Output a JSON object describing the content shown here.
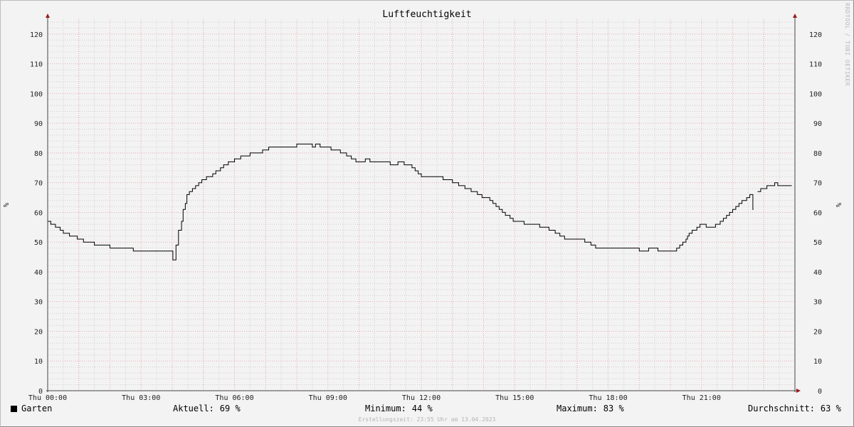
{
  "chart_data": {
    "type": "line",
    "title": "Luftfeuchtigkeit",
    "ylabel": "%",
    "ylim": [
      0,
      125
    ],
    "y_ticks": [
      0,
      10,
      20,
      30,
      40,
      50,
      60,
      70,
      80,
      90,
      100,
      110,
      120
    ],
    "x_range_hours": [
      0,
      24
    ],
    "x_ticks": [
      {
        "hour": 0,
        "label": "Thu 00:00"
      },
      {
        "hour": 3,
        "label": "Thu 03:00"
      },
      {
        "hour": 6,
        "label": "Thu 06:00"
      },
      {
        "hour": 9,
        "label": "Thu 09:00"
      },
      {
        "hour": 12,
        "label": "Thu 12:00"
      },
      {
        "hour": 15,
        "label": "Thu 15:00"
      },
      {
        "hour": 18,
        "label": "Thu 18:00"
      },
      {
        "hour": 21,
        "label": "Thu 21:00"
      }
    ],
    "grid": true,
    "series": [
      {
        "name": "Garten",
        "color": "#000000",
        "segments": [
          [
            [
              0,
              57
            ],
            [
              0.1,
              56
            ],
            [
              0.25,
              55
            ],
            [
              0.4,
              54
            ],
            [
              0.5,
              53
            ],
            [
              0.7,
              52
            ],
            [
              0.95,
              51
            ],
            [
              1.15,
              50
            ],
            [
              1.5,
              49
            ],
            [
              2.0,
              48
            ],
            [
              2.75,
              47
            ],
            [
              3.5,
              47
            ],
            [
              4.0,
              47
            ],
            [
              4.02,
              44
            ],
            [
              4.1,
              44
            ],
            [
              4.12,
              49
            ],
            [
              4.2,
              54
            ],
            [
              4.3,
              57
            ],
            [
              4.35,
              61
            ],
            [
              4.42,
              63
            ],
            [
              4.47,
              66
            ],
            [
              4.55,
              67
            ],
            [
              4.65,
              68
            ],
            [
              4.75,
              69
            ],
            [
              4.85,
              70
            ],
            [
              4.95,
              71
            ],
            [
              5.1,
              72
            ],
            [
              5.3,
              73
            ],
            [
              5.4,
              74
            ],
            [
              5.55,
              75
            ],
            [
              5.65,
              76
            ],
            [
              5.8,
              77
            ],
            [
              6.0,
              78
            ],
            [
              6.2,
              79
            ],
            [
              6.5,
              80
            ],
            [
              6.9,
              81
            ],
            [
              7.1,
              82
            ],
            [
              7.5,
              82
            ],
            [
              8.0,
              83
            ],
            [
              8.4,
              83
            ],
            [
              8.5,
              82
            ],
            [
              8.6,
              83
            ],
            [
              8.75,
              82
            ],
            [
              9.1,
              81
            ],
            [
              9.4,
              80
            ],
            [
              9.6,
              79
            ],
            [
              9.75,
              78
            ],
            [
              9.9,
              77
            ],
            [
              10.2,
              78
            ],
            [
              10.35,
              77
            ],
            [
              10.9,
              77
            ],
            [
              11.0,
              76
            ],
            [
              11.25,
              77
            ],
            [
              11.45,
              76
            ],
            [
              11.7,
              75
            ],
            [
              11.8,
              74
            ],
            [
              11.9,
              73
            ],
            [
              12.0,
              72
            ],
            [
              12.3,
              72
            ],
            [
              12.5,
              72
            ],
            [
              12.7,
              71
            ],
            [
              13.0,
              70
            ],
            [
              13.2,
              69
            ],
            [
              13.4,
              68
            ],
            [
              13.6,
              67
            ],
            [
              13.8,
              66
            ],
            [
              13.95,
              65
            ],
            [
              14.2,
              64
            ],
            [
              14.3,
              63
            ],
            [
              14.4,
              62
            ],
            [
              14.5,
              61
            ],
            [
              14.6,
              60
            ],
            [
              14.7,
              59
            ],
            [
              14.85,
              58
            ],
            [
              14.95,
              57
            ],
            [
              15.3,
              56
            ],
            [
              15.8,
              55
            ],
            [
              16.1,
              54
            ],
            [
              16.3,
              53
            ],
            [
              16.45,
              52
            ],
            [
              16.6,
              51
            ],
            [
              17.0,
              51
            ],
            [
              17.25,
              50
            ],
            [
              17.45,
              49
            ],
            [
              17.6,
              48
            ],
            [
              18.0,
              48
            ],
            [
              18.5,
              48
            ],
            [
              19.0,
              47
            ],
            [
              19.3,
              48
            ],
            [
              19.6,
              47
            ],
            [
              20.1,
              47
            ],
            [
              20.2,
              48
            ],
            [
              20.3,
              49
            ],
            [
              20.4,
              50
            ],
            [
              20.5,
              51
            ],
            [
              20.55,
              52
            ],
            [
              20.6,
              53
            ],
            [
              20.7,
              54
            ],
            [
              20.85,
              55
            ],
            [
              20.95,
              56
            ],
            [
              21.15,
              55
            ],
            [
              21.45,
              56
            ],
            [
              21.6,
              57
            ],
            [
              21.7,
              58
            ],
            [
              21.8,
              59
            ],
            [
              21.9,
              60
            ],
            [
              22.0,
              61
            ],
            [
              22.1,
              62
            ],
            [
              22.2,
              63
            ],
            [
              22.3,
              64
            ],
            [
              22.45,
              65
            ],
            [
              22.55,
              66
            ],
            [
              22.62,
              66
            ],
            [
              22.65,
              61
            ],
            [
              22.67,
              61
            ]
          ],
          [
            [
              22.8,
              67
            ],
            [
              22.9,
              68
            ],
            [
              23.1,
              69
            ],
            [
              23.35,
              70
            ],
            [
              23.45,
              69
            ],
            [
              23.9,
              69
            ]
          ]
        ]
      }
    ],
    "legend": {
      "name": "Garten",
      "color": "#000000",
      "placement": "bottom-left"
    },
    "stats": [
      {
        "label": "Aktuell:",
        "value": "69 %"
      },
      {
        "label": "Minimum:",
        "value": "44 %"
      },
      {
        "label": "Maximum:",
        "value": "83 %"
      },
      {
        "label": "Durchschnitt:",
        "value": "63 %"
      }
    ],
    "creation_time": "Erstellungszeit: 23:55 Uhr am 13.04.2023",
    "watermark": "RRDTOOL / TOBI OETIKER"
  }
}
